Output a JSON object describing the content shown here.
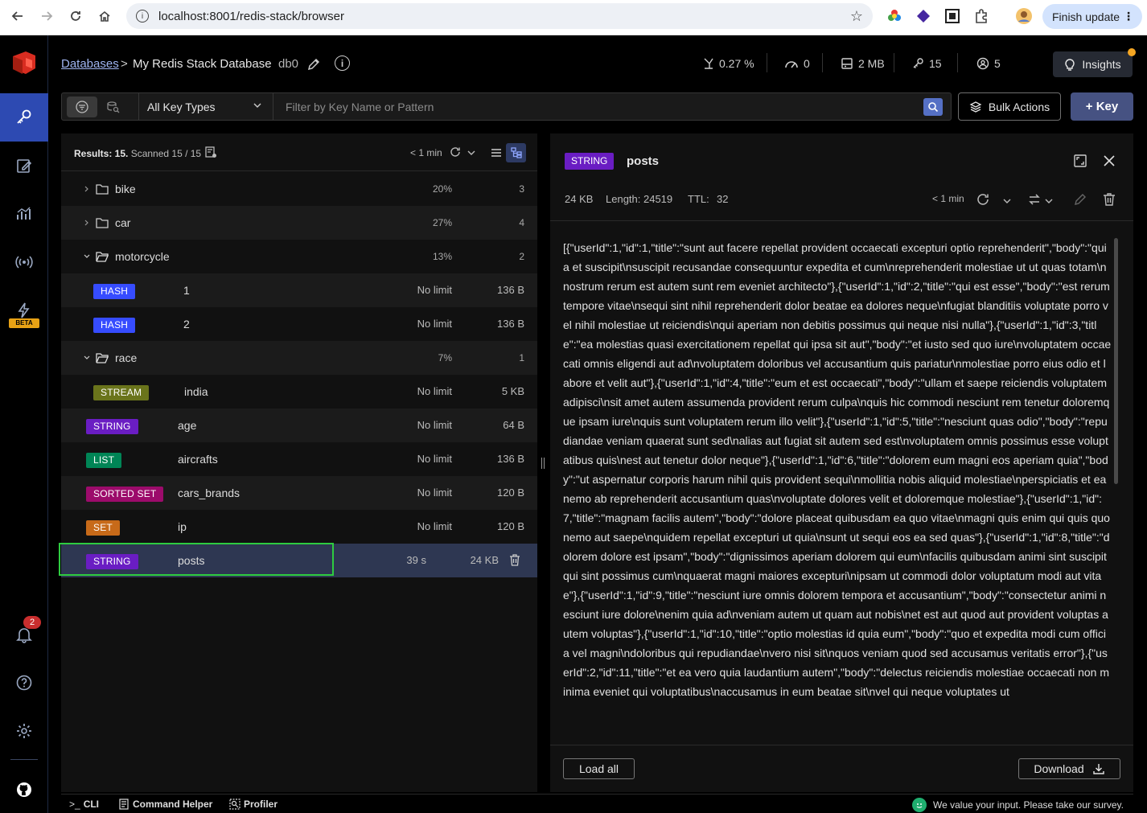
{
  "browser": {
    "url": "localhost:8001/redis-stack/browser",
    "finish_update_label": "Finish update"
  },
  "header": {
    "breadcrumb_link": "Databases",
    "breadcrumb_sep": ">",
    "database_name": "My Redis Stack Database",
    "db_index": "db0",
    "stats": {
      "cpu": "0.27 %",
      "ops": "0",
      "memory": "2 MB",
      "keys": "15",
      "clients": "5"
    },
    "insights_label": "Insights"
  },
  "filter": {
    "key_type": "All Key Types",
    "placeholder": "Filter by Key Name or Pattern",
    "bulk_actions_label": "Bulk Actions",
    "add_key_label": "+ Key"
  },
  "sidebar": {
    "beta_label": "BETA",
    "notification_count": "2"
  },
  "list": {
    "results_label": "Results: 15.",
    "scanned_label": "Scanned 15 / 15",
    "refresh_label": "< 1 min",
    "rows": [
      {
        "kind": "folder",
        "name": "bike",
        "pct": "20%",
        "count": "3",
        "expanded": false
      },
      {
        "kind": "folder",
        "name": "car",
        "pct": "27%",
        "count": "4",
        "expanded": false
      },
      {
        "kind": "folder",
        "name": "motorcycle",
        "pct": "13%",
        "count": "2",
        "expanded": true
      },
      {
        "kind": "key",
        "type": "HASH",
        "name": "1",
        "ttl": "No limit",
        "size": "136 B",
        "nested": true
      },
      {
        "kind": "key",
        "type": "HASH",
        "name": "2",
        "ttl": "No limit",
        "size": "136 B",
        "nested": true
      },
      {
        "kind": "folder",
        "name": "race",
        "pct": "7%",
        "count": "1",
        "expanded": true
      },
      {
        "kind": "key",
        "type": "STREAM",
        "name": "india",
        "ttl": "No limit",
        "size": "5 KB",
        "nested": true
      },
      {
        "kind": "key",
        "type": "STRING",
        "name": "age",
        "ttl": "No limit",
        "size": "64 B"
      },
      {
        "kind": "key",
        "type": "LIST",
        "name": "aircrafts",
        "ttl": "No limit",
        "size": "136 B"
      },
      {
        "kind": "key",
        "type": "SORTED SET",
        "name": "cars_brands",
        "ttl": "No limit",
        "size": "120 B"
      },
      {
        "kind": "key",
        "type": "SET",
        "name": "ip",
        "ttl": "No limit",
        "size": "120 B"
      },
      {
        "kind": "key",
        "type": "STRING",
        "name": "posts",
        "ttl": "39 s",
        "size": "24 KB",
        "selected": true
      }
    ]
  },
  "detail": {
    "type": "STRING",
    "key_name": "posts",
    "size": "24 KB",
    "length": "Length: 24519",
    "ttl_label": "TTL:",
    "ttl_value": "32",
    "refresh_label": "< 1 min",
    "value": "[{\"userId\":1,\"id\":1,\"title\":\"sunt aut facere repellat provident occaecati excepturi optio reprehenderit\",\"body\":\"quia et suscipit\\nsuscipit recusandae consequuntur expedita et cum\\nreprehenderit molestiae ut ut quas totam\\nnostrum rerum est autem sunt rem eveniet architecto\"},{\"userId\":1,\"id\":2,\"title\":\"qui est esse\",\"body\":\"est rerum tempore vitae\\nsequi sint nihil reprehenderit dolor beatae ea dolores neque\\nfugiat blanditiis voluptate porro vel nihil molestiae ut reiciendis\\nqui aperiam non debitis possimus qui neque nisi nulla\"},{\"userId\":1,\"id\":3,\"title\":\"ea molestias quasi exercitationem repellat qui ipsa sit aut\",\"body\":\"et iusto sed quo iure\\nvoluptatem occaecati omnis eligendi aut ad\\nvoluptatem doloribus vel accusantium quis pariatur\\nmolestiae porro eius odio et labore et velit aut\"},{\"userId\":1,\"id\":4,\"title\":\"eum et est occaecati\",\"body\":\"ullam et saepe reiciendis voluptatem adipisci\\nsit amet autem assumenda provident rerum culpa\\nquis hic commodi nesciunt rem tenetur doloremque ipsam iure\\nquis sunt voluptatem rerum illo velit\"},{\"userId\":1,\"id\":5,\"title\":\"nesciunt quas odio\",\"body\":\"repudiandae veniam quaerat sunt sed\\nalias aut fugiat sit autem sed est\\nvoluptatem omnis possimus esse voluptatibus quis\\nest aut tenetur dolor neque\"},{\"userId\":1,\"id\":6,\"title\":\"dolorem eum magni eos aperiam quia\",\"body\":\"ut aspernatur corporis harum nihil quis provident sequi\\nmollitia nobis aliquid molestiae\\nperspiciatis et ea nemo ab reprehenderit accusantium quas\\nvoluptate dolores velit et doloremque molestiae\"},{\"userId\":1,\"id\":7,\"title\":\"magnam facilis autem\",\"body\":\"dolore placeat quibusdam ea quo vitae\\nmagni quis enim qui quis quo nemo aut saepe\\nquidem repellat excepturi ut quia\\nsunt ut sequi eos ea sed quas\"},{\"userId\":1,\"id\":8,\"title\":\"dolorem dolore est ipsam\",\"body\":\"dignissimos aperiam dolorem qui eum\\nfacilis quibusdam animi sint suscipit qui sint possimus cum\\nquaerat magni maiores excepturi\\nipsam ut commodi dolor voluptatum modi aut vitae\"},{\"userId\":1,\"id\":9,\"title\":\"nesciunt iure omnis dolorem tempora et accusantium\",\"body\":\"consectetur animi nesciunt iure dolore\\nenim quia ad\\nveniam autem ut quam aut nobis\\net est aut quod aut provident voluptas autem voluptas\"},{\"userId\":1,\"id\":10,\"title\":\"optio molestias id quia eum\",\"body\":\"quo et expedita modi cum officia vel magni\\ndoloribus qui repudiandae\\nvero nisi sit\\nquos veniam quod sed accusamus veritatis error\"},{\"userId\":2,\"id\":11,\"title\":\"et ea vero quia laudantium autem\",\"body\":\"delectus reiciendis molestiae occaecati non minima eveniet qui voluptatibus\\naccusamus in eum beatae sit\\nvel qui neque voluptates ut",
    "load_all_label": "Load all",
    "download_label": "Download"
  },
  "bottom": {
    "cli_label": "CLI",
    "command_helper_label": "Command Helper",
    "profiler_label": "Profiler",
    "survey_label": "We value your input. Please take our survey."
  },
  "colors": {
    "accent": "#465282",
    "hash": "#364cff",
    "stream": "#6a741b",
    "string": "#6a1dc3",
    "list": "#008556",
    "sorted_set": "#9c0b6b",
    "set": "#c76a19",
    "selection_outline": "#2ecc40"
  }
}
